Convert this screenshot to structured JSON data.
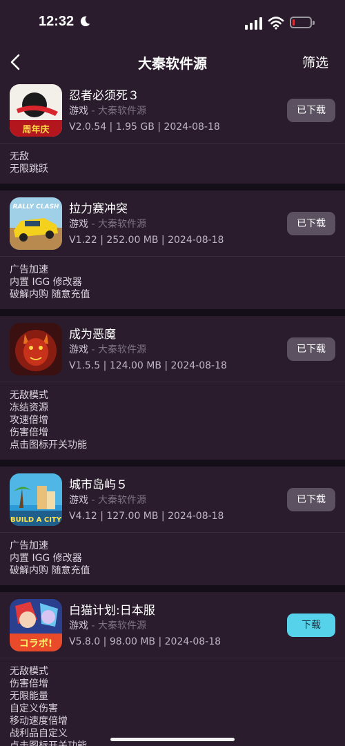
{
  "status": {
    "time": "12:32",
    "battery_level": 0.12
  },
  "nav": {
    "title": "大秦软件源",
    "filter": "筛选"
  },
  "apps": [
    {
      "name": "忍者必须死３",
      "category": "游戏",
      "source": " - 大秦软件源",
      "meta": "V2.0.54 | 1.95 GB | 2024-08-18",
      "button": "已下载",
      "desc": [
        "无敌",
        "无限跳跃"
      ],
      "icon": "ninja-game-icon",
      "icon_badge": "周年庆"
    },
    {
      "name": "拉力赛冲突",
      "category": "游戏",
      "source": " - 大秦软件源",
      "meta": "V1.22 | 252.00 MB | 2024-08-18",
      "button": "已下载",
      "desc": [
        "广告加速",
        "内置 IGG 修改器",
        "破解内购  随意充值"
      ],
      "icon": "rally-car-game-icon",
      "icon_badge": "RALLY CLASH"
    },
    {
      "name": "成为恶魔",
      "category": "游戏",
      "source": " - 大秦软件源",
      "meta": "V1.5.5 | 124.00 MB | 2024-08-18",
      "button": "已下载",
      "desc": [
        "无敌模式",
        "冻结资源",
        "攻速倍增",
        "伤害倍增",
        "点击图标开关功能"
      ],
      "icon": "demon-game-icon"
    },
    {
      "name": "城市岛屿５",
      "category": "游戏",
      "source": " - 大秦软件源",
      "meta": "V4.12 | 127.00 MB | 2024-08-18",
      "button": "已下载",
      "desc": [
        "广告加速",
        "内置 IGG 修改器",
        "破解内购  随意充值"
      ],
      "icon": "city-island-game-icon",
      "icon_badge": "BUILD A CITY"
    },
    {
      "name": "白猫计划:日本服",
      "category": "游戏",
      "source": " - 大秦软件源",
      "meta": "V5.8.0 | 98.00 MB | 2024-08-18",
      "button": "下载",
      "desc": [
        "无敌模式",
        "伤害倍增",
        "无限能量",
        "自定义伤害",
        "移动速度倍增",
        "战利品自定义",
        "点击图标开关功能"
      ],
      "icon": "white-cat-game-icon",
      "icon_badge": "コラボ!"
    }
  ],
  "colors": {
    "accent": "#56d2ea",
    "card": "#2a1c2d",
    "background": "#140e18"
  }
}
